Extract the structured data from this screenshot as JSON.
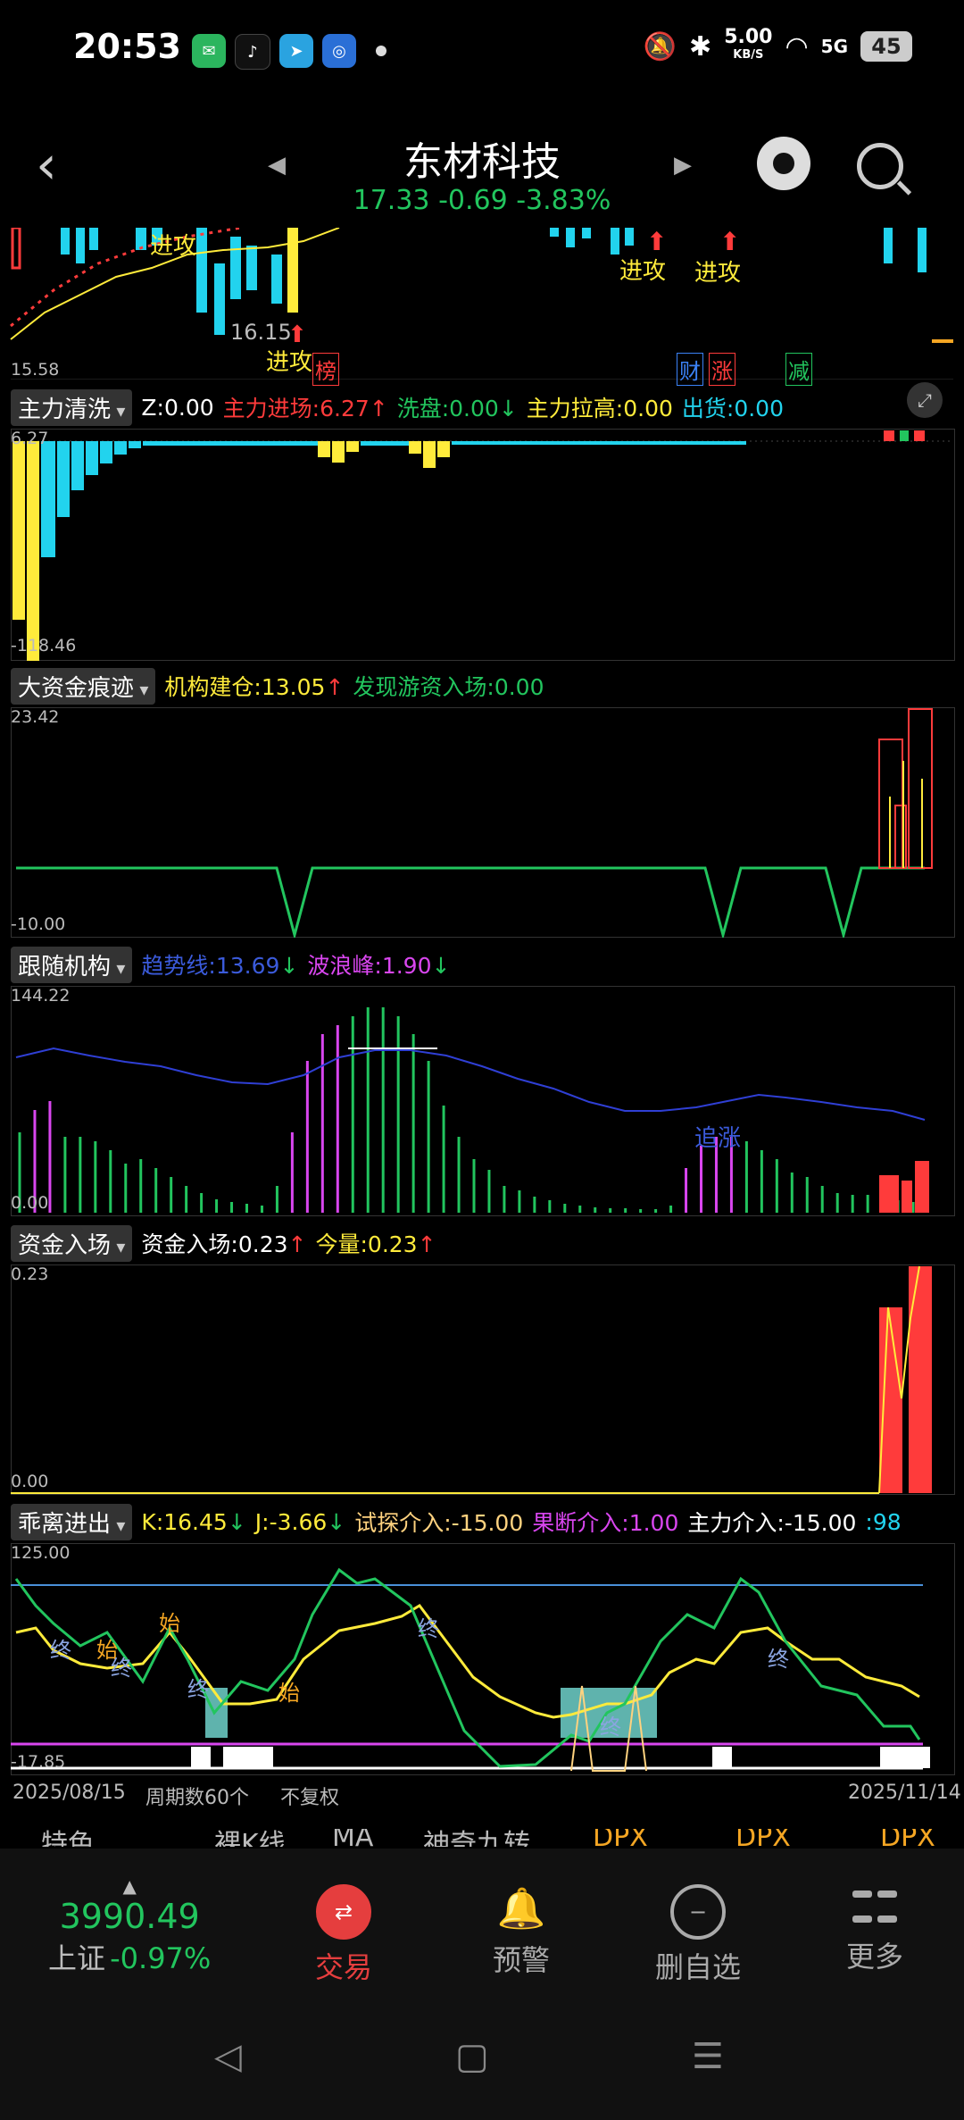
{
  "status": {
    "time": "20:53",
    "net_speed": "5.00",
    "net_unit": "KB/S",
    "signal": "5G",
    "battery": "45",
    "apps": [
      {
        "name": "wechat-icon",
        "color": "#2bb55e",
        "glyph": "✉"
      },
      {
        "name": "tiktok-icon",
        "color": "#111",
        "glyph": "♪"
      },
      {
        "name": "telegram-icon",
        "color": "#2aa3e0",
        "glyph": "➤"
      },
      {
        "name": "browser-icon",
        "color": "#2a6fd6",
        "glyph": "◎"
      }
    ]
  },
  "header": {
    "title": "东材科技",
    "price": "17.33",
    "change": "-0.69",
    "change_pct": "-3.83%"
  },
  "kline": {
    "low_label": "15.58",
    "min_label": "16.15",
    "labels": {
      "attack": "进攻",
      "rank": "榜",
      "cai": "财",
      "zhang": "涨",
      "jian": "减"
    }
  },
  "panel1": {
    "name": "主力清洗",
    "items": [
      {
        "label": "Z:",
        "value": "0.00",
        "color": "#ffffff",
        "arrow": ""
      },
      {
        "label": "主力进场:",
        "value": "6.27",
        "color": "#ff3b3b",
        "arrow": "↑"
      },
      {
        "label": "洗盘:",
        "value": "0.00",
        "color": "#22c55e",
        "arrow": "↓"
      },
      {
        "label": "主力拉高:",
        "value": "0.00",
        "color": "#ffeb3b",
        "arrow": ""
      },
      {
        "label": "出货:",
        "value": "0.00",
        "color": "#22d3ee",
        "arrow": ""
      }
    ],
    "ymax": "6.27",
    "ymin": "-118.46"
  },
  "panel2": {
    "name": "大资金痕迹",
    "items": [
      {
        "label": "机构建仓:",
        "value": "13.05",
        "color": "#ffeb3b",
        "arrow": "↑"
      },
      {
        "label": "发现游资入场:",
        "value": "0.00",
        "color": "#22c55e",
        "arrow": ""
      }
    ],
    "ymax": "23.42",
    "ymin": "-10.00"
  },
  "panel3": {
    "name": "跟随机构",
    "items": [
      {
        "label": "趋势线:",
        "value": "13.69",
        "color": "#3b5bdb",
        "arrow": "↓"
      },
      {
        "label": "波浪峰:",
        "value": "1.90",
        "color": "#d946ef",
        "arrow": "↓"
      }
    ],
    "ymax": "144.22",
    "ymin": "0.00",
    "note": "追涨"
  },
  "panel4": {
    "name": "资金入场",
    "items": [
      {
        "label": "资金入场:",
        "value": "0.23",
        "color": "#ffffff",
        "arrow": "↑"
      },
      {
        "label": "今量:",
        "value": "0.23",
        "color": "#ffeb3b",
        "arrow": "↑"
      }
    ],
    "ymax": "0.23",
    "ymin": "0.00"
  },
  "panel5": {
    "name": "乖离进出",
    "items": [
      {
        "label": "K:",
        "value": "16.45",
        "color": "#ffeb3b",
        "arrow": "↓"
      },
      {
        "label": "J:",
        "value": "-3.66",
        "color": "#ffeb3b",
        "arrow": "↓"
      },
      {
        "label": "试探介入:",
        "value": "-15.00",
        "color": "#ffd27f",
        "arrow": ""
      },
      {
        "label": "果断介入:",
        "value": "1.00",
        "color": "#d946ef",
        "arrow": ""
      },
      {
        "label": "主力介入:",
        "value": "-15.00",
        "color": "#ffffff",
        "arrow": ""
      }
    ],
    "trail": ":98",
    "ymax": "125.00",
    "ymin": "-17.85",
    "marks": {
      "start": "始",
      "end": "终"
    }
  },
  "footer": {
    "start_date": "2025/08/15",
    "period": "周期数60个",
    "adjust": "不复权",
    "end_date": "2025/11/14"
  },
  "tabs": [
    "特色",
    "裸K线",
    "MA",
    "神奇九转",
    "DPX",
    "DPX",
    "DPX"
  ],
  "bottom": {
    "index_value": "3990.49",
    "index_name": "上证",
    "index_pct": "-0.97%",
    "nav": [
      {
        "label": "交易",
        "icon": "exchange-icon",
        "glyph": "⇄",
        "active": true
      },
      {
        "label": "预警",
        "icon": "bell-icon",
        "glyph": "🔔",
        "active": false
      },
      {
        "label": "删自选",
        "icon": "remove-icon",
        "glyph": "−",
        "active": false
      },
      {
        "label": "更多",
        "icon": "grid-icon",
        "glyph": "",
        "active": false
      }
    ]
  },
  "colors": {
    "up": "#ff3b3b",
    "down": "#22c55e",
    "cyan": "#22d3ee",
    "yellow": "#ffeb3b",
    "magenta": "#d946ef",
    "blue": "#3b5bdb"
  }
}
